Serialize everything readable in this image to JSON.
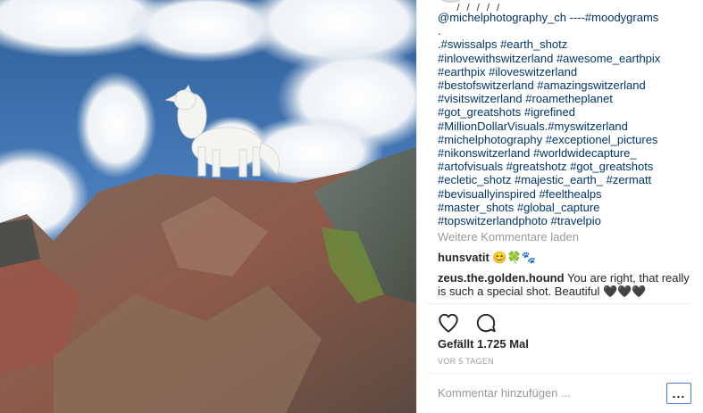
{
  "post": {
    "caption_cut": "___/_/_/_/_/_ _ _ _",
    "caption_lines": [
      "@michelphotography_ch ----#moodygrams",
      ".",
      ".#swissalps #earth_shotz",
      "#inlovewithswitzerland #awesome_earthpix",
      "#earthpix #iloveswitzerland",
      "#bestofswitzerland #amazingswitzerland",
      "#visitswitzerland #roametheplanet",
      "#got_greatshots #igrefined",
      "#MillionDollarVisuals.#myswitzerland",
      "#michelphotography #exceptionel_pictures",
      "#nikonswitzerland #worldwidecapture_",
      "#artofvisuals #greatshotz #got_greatshots",
      "#ecletic_shotz #majestic_earth_ #zermatt",
      "#bevisuallyinspired #feelthealps",
      "#master_shots #global_capture",
      "#topswitzerlandphoto #travelpio"
    ],
    "load_more": "Weitere Kommentare laden",
    "comments": [
      {
        "user": "hunsvatit",
        "text": "😊🍀🐾"
      },
      {
        "user": "zeus.the.golden.hound",
        "text": "You are right, that really is such a special shot. Beautiful 🖤🖤🖤"
      }
    ],
    "likes": "Gefällt 1.725 Mal",
    "timestamp": "VOR 5 TAGEN",
    "comment_placeholder": "Kommentar hinzufügen ...",
    "more_label": "..."
  },
  "icons": {
    "like": "heart-outline-icon",
    "comment": "speech-bubble-icon",
    "more": "more-dots-icon"
  },
  "colors": {
    "hashtag": "#003569",
    "muted": "#999999",
    "text": "#262626",
    "focus_border": "#4a7dc9"
  }
}
